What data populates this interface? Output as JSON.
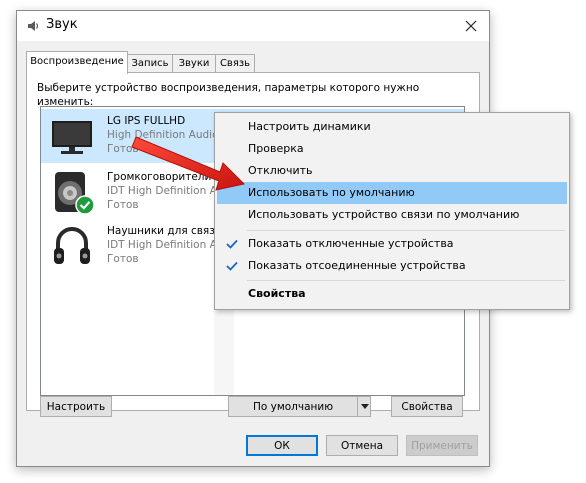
{
  "window": {
    "title": "Звук",
    "tabs": [
      {
        "label": "Воспроизведение",
        "active": true
      },
      {
        "label": "Запись",
        "active": false
      },
      {
        "label": "Звуки",
        "active": false
      },
      {
        "label": "Связь",
        "active": false
      }
    ]
  },
  "playback": {
    "instruction": "Выберите устройство воспроизведения, параметры которого нужно изменить:",
    "devices": [
      {
        "name": "LG IPS FULLHD",
        "description": "High Definition Audio",
        "status": "Готов",
        "icon": "monitor-icon",
        "selected": true
      },
      {
        "name": "Громкоговорители",
        "description": "IDT High Definition Audio",
        "status": "Готов",
        "icon": "speaker-icon",
        "default_badge": "default-check-icon"
      },
      {
        "name": "Наушники для связи",
        "description": "IDT High Definition Audio",
        "status": "Готов",
        "icon": "headphones-icon"
      }
    ]
  },
  "buttons": {
    "configure": "Настроить",
    "set_default": "По умолчанию",
    "properties": "Свойства",
    "ok": "ОК",
    "cancel": "Отмена",
    "apply": "Применить"
  },
  "context_menu": {
    "items": [
      {
        "label": "Настроить динамики"
      },
      {
        "label": "Проверка"
      },
      {
        "label": "Отключить"
      },
      {
        "label": "Использовать по умолчанию",
        "highlighted": true
      },
      {
        "label": "Использовать устройство связи по умолчанию"
      },
      {
        "label": "Показать отключенные устройства",
        "checked": true
      },
      {
        "label": "Показать отсоединенные устройства",
        "checked": true
      },
      {
        "label": "Свойства",
        "bold": true
      }
    ]
  },
  "colors": {
    "selection": "#cce8ff",
    "menu_highlight": "#91c9f7",
    "accent": "#0078d7",
    "arrow": "#e8201c",
    "check_green": "#1e9c3a"
  }
}
